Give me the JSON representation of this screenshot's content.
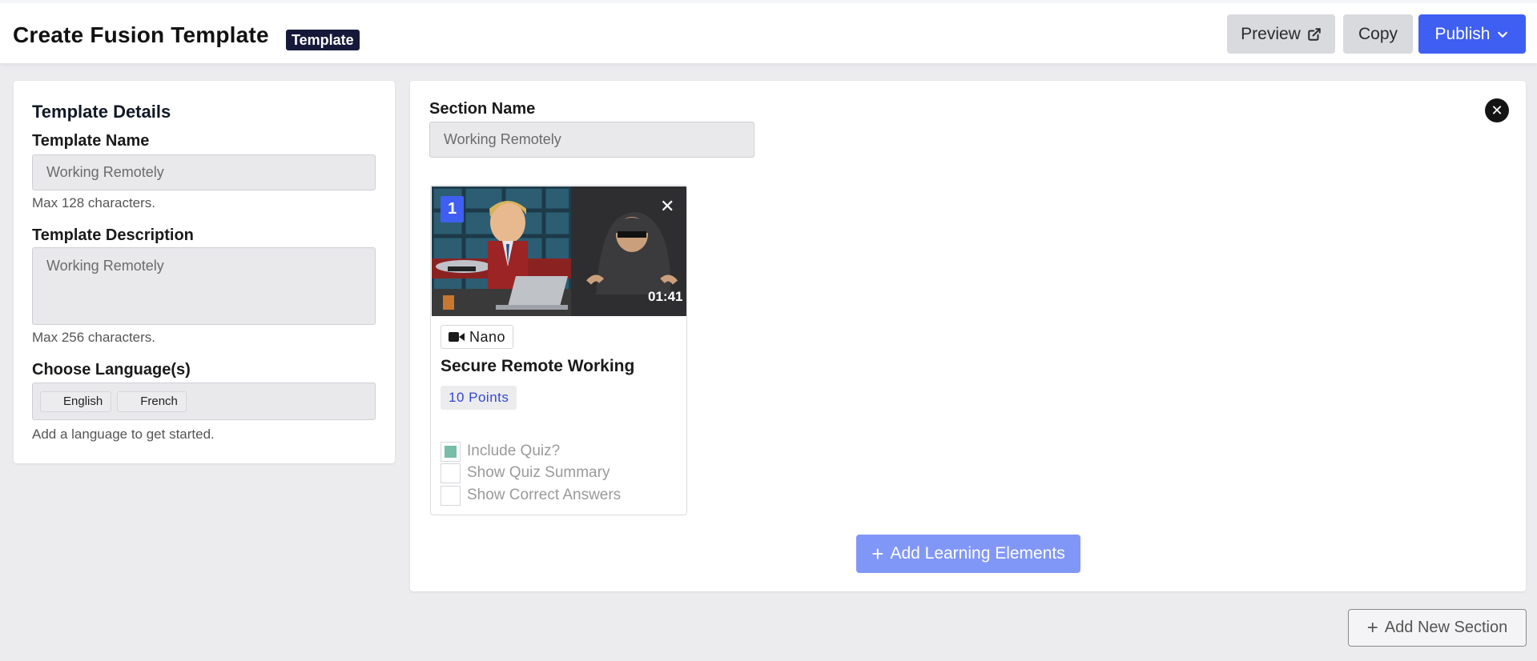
{
  "header": {
    "title": "Create Fusion Template",
    "badge": "Template",
    "preview_label": "Preview",
    "copy_label": "Copy",
    "publish_label": "Publish"
  },
  "template_details": {
    "title": "Template Details",
    "name_label": "Template Name",
    "name_value": "Working Remotely",
    "name_hint": "Max 128 characters.",
    "description_label": "Template Description",
    "description_value": "Working Remotely",
    "description_hint": "Max 256 characters.",
    "language_label": "Choose Language(s)",
    "languages": [
      "English",
      "French"
    ],
    "language_hint": "Add a language to get started."
  },
  "section": {
    "name_label": "Section Name",
    "name_value": "Working Remotely",
    "element": {
      "number": "1",
      "duration": "01:41",
      "type": "Nano",
      "title": "Secure Remote Working",
      "points": "10 Points",
      "include_quiz_label": "Include Quiz?",
      "include_quiz_checked": true,
      "show_summary_label": "Show Quiz Summary",
      "show_summary_checked": false,
      "show_answers_label": "Show Correct Answers",
      "show_answers_checked": false
    },
    "add_elements_label": "Add Learning Elements"
  },
  "add_section_label": "Add New Section",
  "colors": {
    "primary": "#3f5ff2",
    "primary_light": "#8197f8",
    "badge_dark": "#17193b",
    "quiz_check": "#77bda8"
  }
}
